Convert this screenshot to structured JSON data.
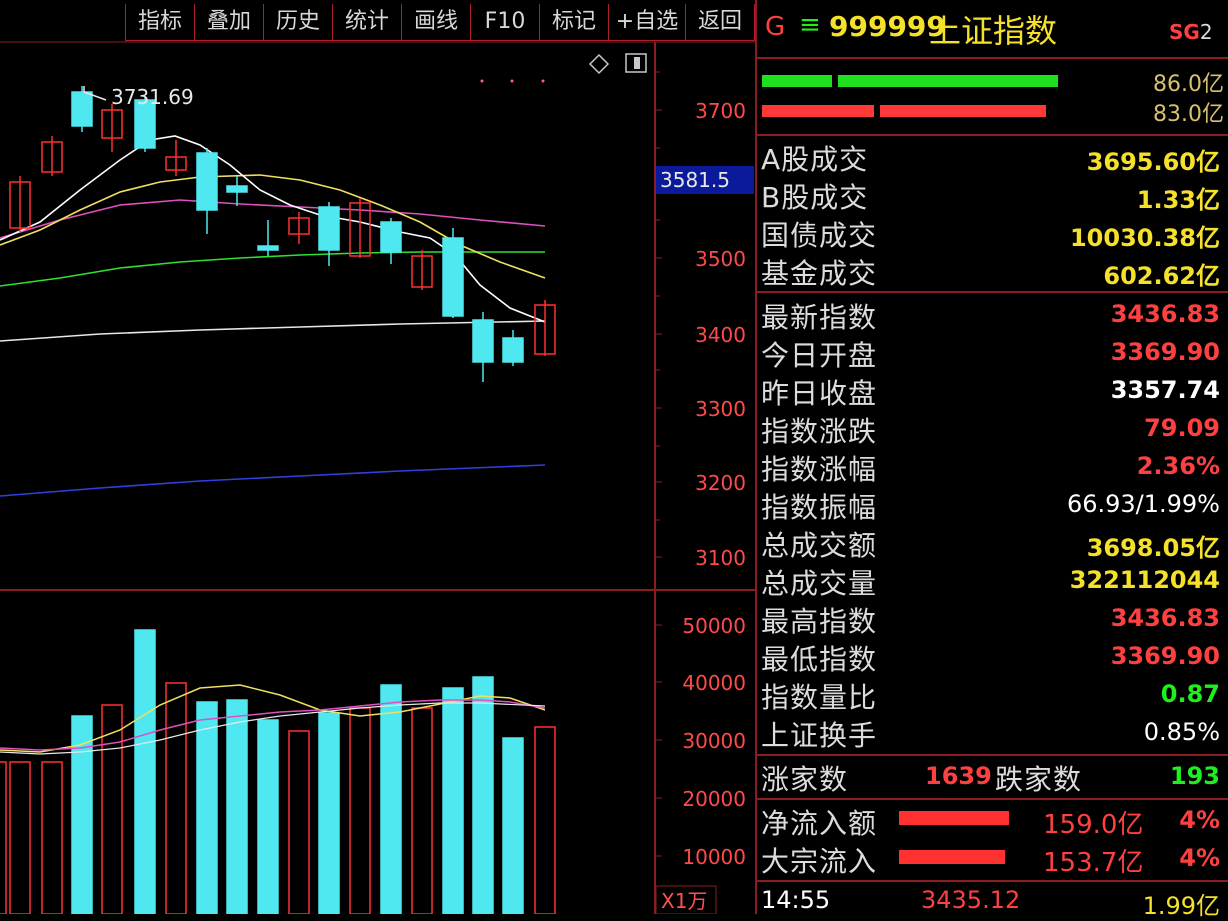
{
  "toolbar": {
    "buttons": [
      "指标",
      "叠加",
      "历史",
      "统计",
      "画线",
      "F10",
      "标记",
      "+自选",
      "返回"
    ]
  },
  "chart": {
    "high_marker": "3731.69",
    "current_price_tag": "3581.5",
    "price_axis": [
      "3700",
      "3500",
      "3400",
      "3300",
      "3200",
      "3100"
    ],
    "volume_axis": [
      "50000",
      "40000",
      "30000",
      "20000",
      "10000"
    ],
    "volume_unit": "X1万",
    "colors": {
      "up": "#ff3030",
      "down": "#4fe8f0",
      "ma5": "#ffffff",
      "ma10": "#f0e060",
      "ma20": "#e050c0",
      "ma60": "#30e030",
      "ma120": "#e8e8e8",
      "ma250": "#3040e0"
    }
  },
  "header": {
    "g": "G",
    "menu_icon": "≡",
    "code": "999999",
    "name": "上证指数",
    "tag": "SG",
    "tag_num": "2"
  },
  "flow_bars": {
    "top_value": "86.0亿",
    "bottom_value": "83.0亿"
  },
  "volumes": [
    {
      "label": "A股成交",
      "value": "3695.60亿",
      "color": "yel"
    },
    {
      "label": "B股成交",
      "value": "1.33亿",
      "color": "yel"
    },
    {
      "label": "国债成交",
      "value": "10030.38亿",
      "color": "yel"
    },
    {
      "label": "基金成交",
      "value": "602.62亿",
      "color": "yel"
    }
  ],
  "stats": [
    {
      "label": "最新指数",
      "value": "3436.83",
      "color": "red"
    },
    {
      "label": "今日开盘",
      "value": "3369.90",
      "color": "red"
    },
    {
      "label": "昨日收盘",
      "value": "3357.74",
      "color": "wht"
    },
    {
      "label": "指数涨跌",
      "value": "79.09",
      "color": "red"
    },
    {
      "label": "指数涨幅",
      "value": "2.36%",
      "color": "red"
    },
    {
      "label": "指数振幅",
      "value": "66.93/1.99%",
      "color": "wht"
    },
    {
      "label": "总成交额",
      "value": "3698.05亿",
      "color": "yel"
    },
    {
      "label": "总成交量",
      "value": "322112044",
      "color": "yel"
    },
    {
      "label": "最高指数",
      "value": "3436.83",
      "color": "red"
    },
    {
      "label": "最低指数",
      "value": "3369.90",
      "color": "red"
    },
    {
      "label": "指数量比",
      "value": "0.87",
      "color": "grn"
    },
    {
      "label": "上证换手",
      "value": "0.85%",
      "color": "wht"
    }
  ],
  "breadth": {
    "up_label": "涨家数",
    "up_value": "1639",
    "down_label": "跌家数",
    "down_value": "193"
  },
  "net_flow": [
    {
      "label": "净流入额",
      "value": "159.0亿",
      "pct": "4%"
    },
    {
      "label": "大宗流入",
      "value": "153.7亿",
      "pct": "4%"
    }
  ],
  "footer": {
    "time": "14:55",
    "price": "3435.12",
    "amount": "1.99亿"
  }
}
